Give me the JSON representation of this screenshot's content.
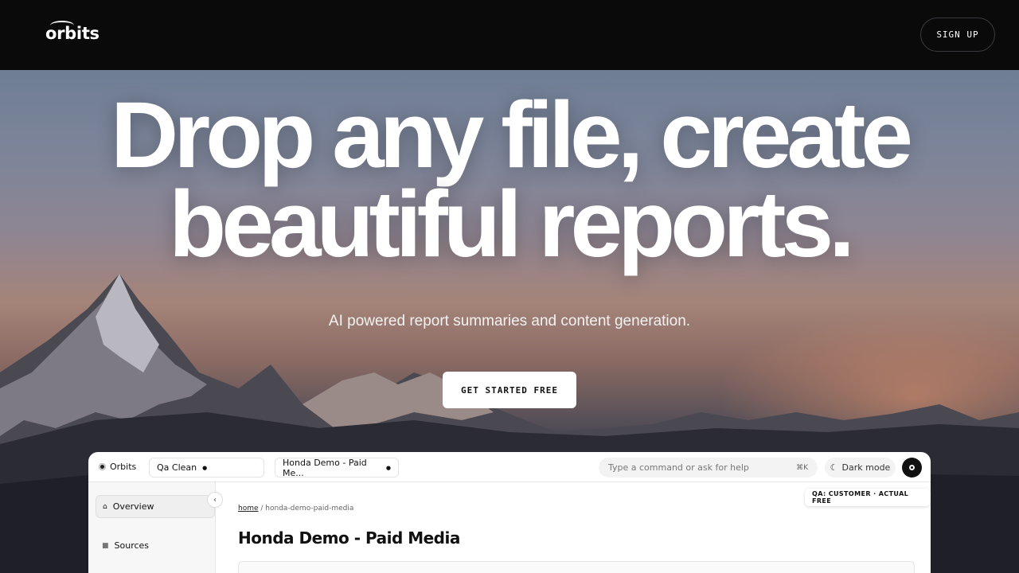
{
  "nav": {
    "logo": "orbits",
    "signup_label": "SIGN UP"
  },
  "hero": {
    "headline_line1": "Drop any file, create",
    "headline_line2": "beautiful reports.",
    "subheadline": "AI powered report summaries and content generation.",
    "cta_label": "GET STARTED FREE"
  },
  "app": {
    "brand": "Orbits",
    "workspace": "Qa Clean",
    "project": "Honda Demo - Paid Me...",
    "command_placeholder": "Type a command or ask for help",
    "command_shortcut": "⌘K",
    "dark_mode_label": "Dark mode",
    "sidebar": [
      {
        "label": "Overview",
        "icon": "home-icon"
      },
      {
        "label": "Sources",
        "icon": "grid-icon"
      }
    ],
    "breadcrumb_home": "home",
    "breadcrumb_current": "honda-demo-paid-media",
    "page_title": "Honda Demo - Paid Media",
    "badge": "QA: CUSTOMER · ACTUAL FREE"
  },
  "colors": {
    "topbar": "#0a0a0b",
    "cta_bg": "#ffffff",
    "text_light": "#ffffff"
  }
}
